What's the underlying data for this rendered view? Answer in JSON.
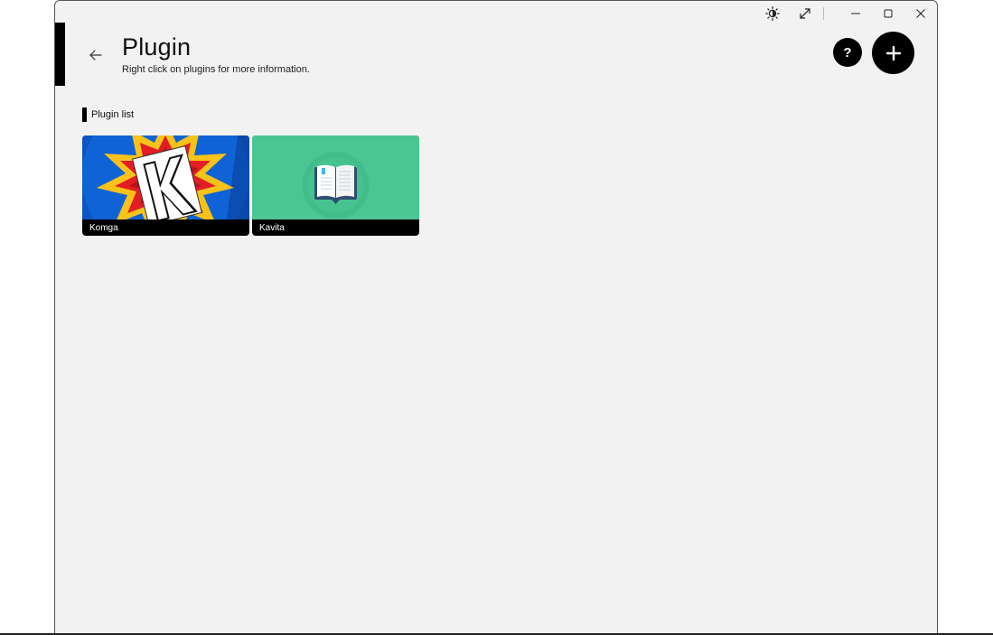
{
  "page": {
    "title": "Plugin",
    "subtitle": "Right click on plugins for more information."
  },
  "titlebar": {
    "icons": [
      "brightness-icon",
      "expand-icon",
      "minimize-icon",
      "maximize-icon",
      "close-icon"
    ]
  },
  "actions": {
    "help_label": "?",
    "add_icon": "plus-icon"
  },
  "section": {
    "label": "Plugin list"
  },
  "plugins": [
    {
      "name": "Komga",
      "icon": "komga-logo"
    },
    {
      "name": "Kavita",
      "icon": "open-book-icon"
    }
  ],
  "colors": {
    "window_bg": "#f2f2f2",
    "accent": "#000000",
    "kavita_bg": "#4bc693",
    "komga_blue": "#0a56c2",
    "komga_yellow": "#f7c21a",
    "komga_red": "#e31d24"
  }
}
